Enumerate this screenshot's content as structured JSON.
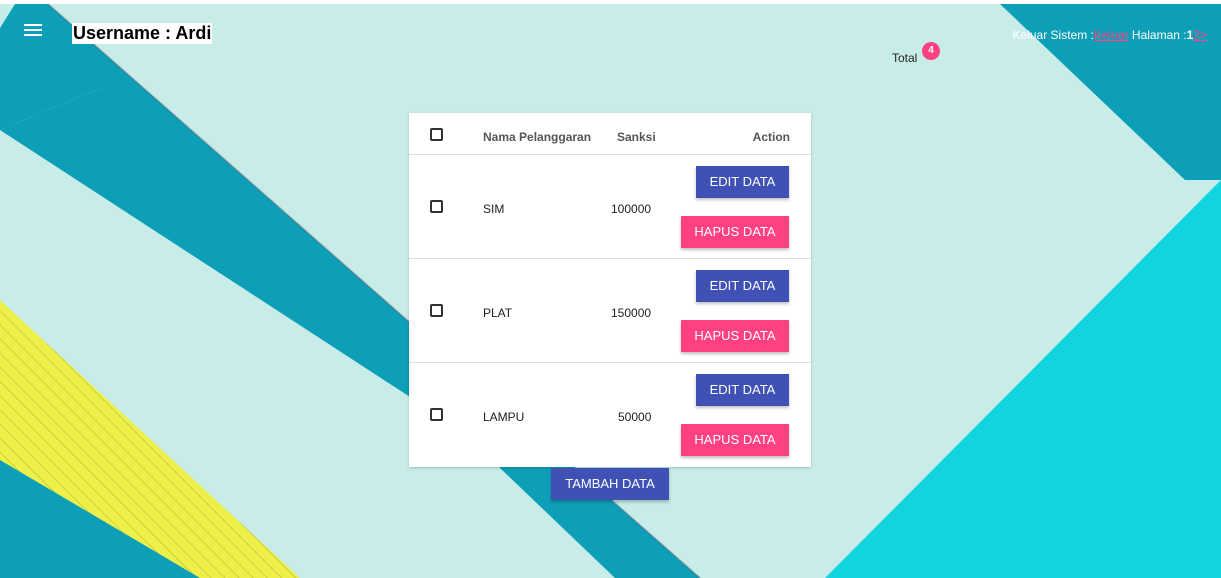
{
  "header": {
    "username_label": "Username : Ardi",
    "keluar_prefix": "Keluar Sistem :",
    "keluar_link": "Keluar",
    "halaman_label": " Halaman :",
    "page_current": "1",
    "page_next": "2",
    "page_next_arrow": ">"
  },
  "summary": {
    "total_label": "Total",
    "total_count": "4"
  },
  "table": {
    "columns": [
      "Nama Pelanggaran",
      "Sanksi",
      "Action"
    ],
    "rows": [
      {
        "nama": "SIM",
        "sanksi": "100000"
      },
      {
        "nama": "PLAT",
        "sanksi": "150000"
      },
      {
        "nama": "LAMPU",
        "sanksi": "50000"
      }
    ],
    "edit_label": "EDIT DATA",
    "hapus_label": "HAPUS DATA"
  },
  "actions": {
    "tambah_label": "TAMBAH DATA"
  },
  "colors": {
    "background": "#c8ede8",
    "teal_band": "#0d9fb8",
    "cyan_panel": "#12d4de",
    "yellow": "#eef04a",
    "primary": "#3f51b5",
    "accent": "#ff4081"
  },
  "icons": {
    "menu": "hamburger-menu-icon"
  }
}
